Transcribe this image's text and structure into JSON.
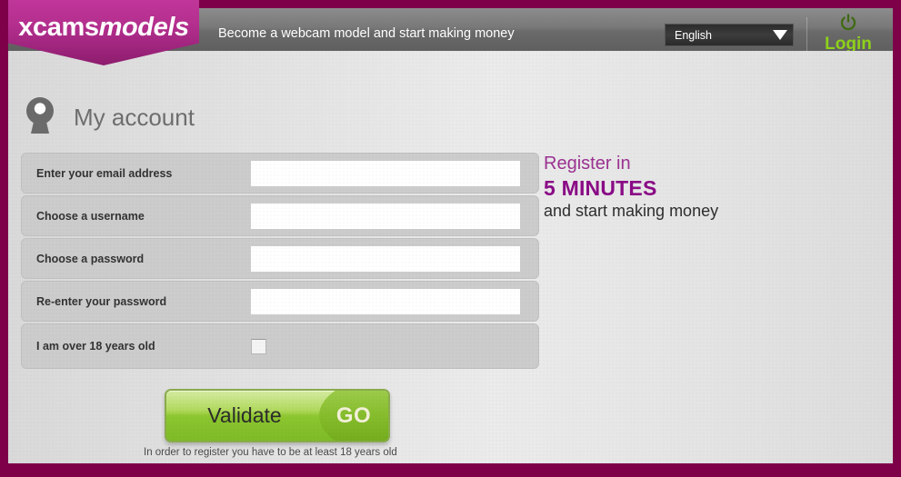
{
  "brand": {
    "logo_primary": "xcams",
    "logo_secondary": "models"
  },
  "header": {
    "tagline": "Become a webcam model and start making money",
    "language": {
      "selected": "English",
      "caret_icon": "chevron-down-icon"
    },
    "login": {
      "label": "Login",
      "icon": "power-icon"
    }
  },
  "account": {
    "icon": "webcam-avatar-icon",
    "title": "My account"
  },
  "form": {
    "fields": [
      {
        "label": "Enter your email address",
        "value": "",
        "type": "email"
      },
      {
        "label": "Choose a username",
        "value": "",
        "type": "text"
      },
      {
        "label": "Choose a password",
        "value": "",
        "type": "password"
      },
      {
        "label": "Re-enter your password",
        "value": "",
        "type": "password"
      }
    ],
    "age_check": {
      "label": "I am over 18 years old",
      "checked": false
    },
    "submit": {
      "label": "Validate",
      "go_label": "GO"
    },
    "disclaimer": "In order to register you have to be at least 18 years old"
  },
  "promo": {
    "line1": "Register in",
    "line2": "5 MINUTES",
    "line3": "and start making money"
  },
  "colors": {
    "page_border": "#7d0049",
    "brand_magenta": "#b42f8e",
    "promo_purple": "#8a0a86",
    "promo_violet": "#9b3191",
    "login_green": "#8fd11a",
    "button_green": "#8cc62f"
  }
}
